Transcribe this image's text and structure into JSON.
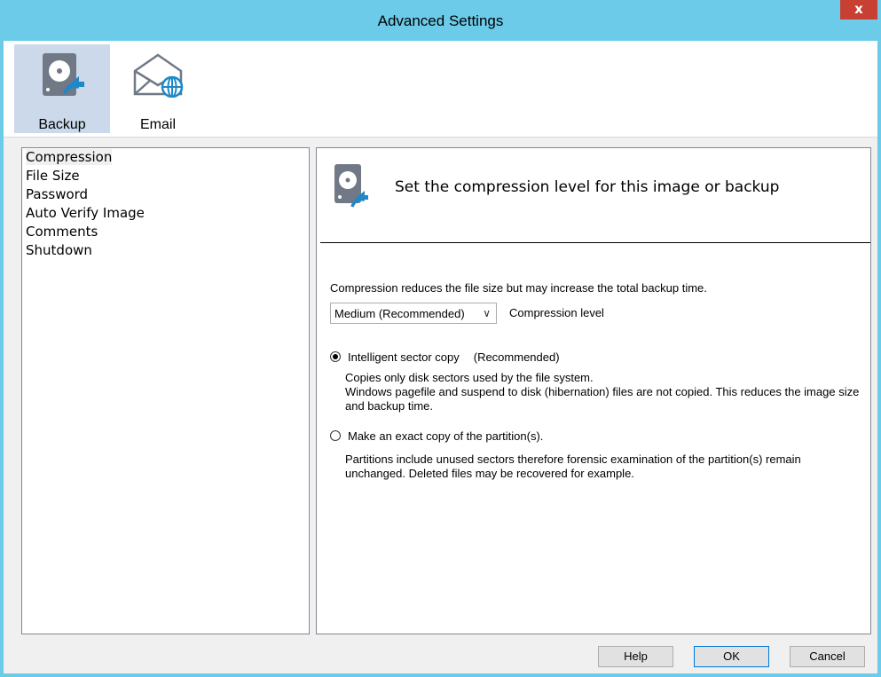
{
  "window": {
    "title": "Advanced Settings",
    "close_label": "x"
  },
  "toolbar": {
    "items": [
      {
        "label": "Backup",
        "icon": "backup-disk-icon",
        "active": true
      },
      {
        "label": "Email",
        "icon": "email-globe-icon",
        "active": false
      }
    ]
  },
  "nav": {
    "items": [
      "Compression",
      "File Size",
      "Password",
      "Auto Verify Image",
      "Comments",
      "Shutdown"
    ],
    "selected": "Compression"
  },
  "panel": {
    "header": "Set the compression level for this image or backup",
    "description": "Compression reduces the file size but may increase the total backup time.",
    "compression_select": {
      "value": "Medium (Recommended)",
      "label": "Compression level"
    },
    "option1": {
      "label": "Intelligent sector copy",
      "recommended": "(Recommended)",
      "checked": true,
      "desc1": "Copies only disk sectors used by the file system.",
      "desc2": "Windows pagefile and suspend to disk (hibernation) files are not copied. This reduces the image size and backup time."
    },
    "option2": {
      "label": "Make an exact copy of the partition(s).",
      "checked": false,
      "desc": "Partitions include unused sectors therefore forensic examination of the partition(s) remain unchanged. Deleted files may be recovered for example."
    }
  },
  "buttons": {
    "help": "Help",
    "ok": "OK",
    "cancel": "Cancel"
  },
  "colors": {
    "titlebar": "#6bcbe9",
    "close": "#c84031",
    "active_tab": "#cbd9ea",
    "icon_gray": "#707985",
    "icon_blue": "#1e88c8"
  }
}
